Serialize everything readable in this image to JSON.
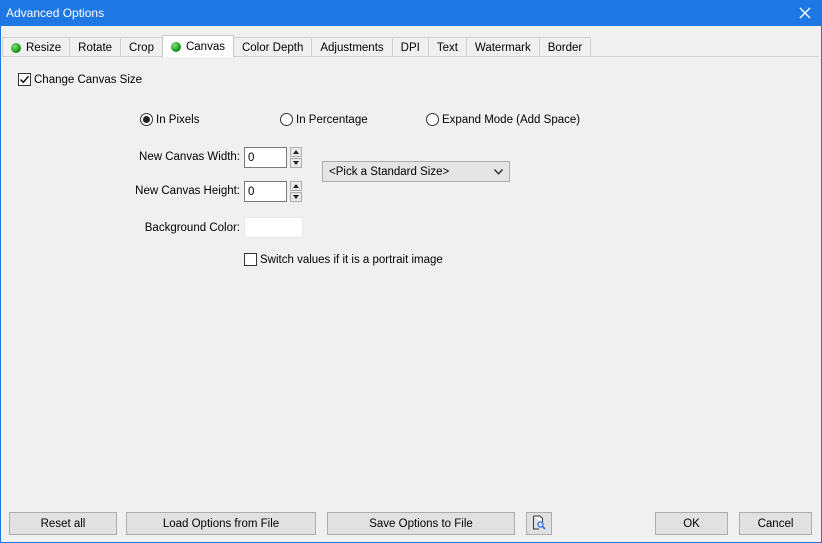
{
  "window": {
    "title": "Advanced Options"
  },
  "tabs": [
    {
      "label": "Resize",
      "indicator": true,
      "active": false
    },
    {
      "label": "Rotate",
      "indicator": false,
      "active": false
    },
    {
      "label": "Crop",
      "indicator": false,
      "active": false
    },
    {
      "label": "Canvas",
      "indicator": true,
      "active": true
    },
    {
      "label": "Color Depth",
      "indicator": false,
      "active": false
    },
    {
      "label": "Adjustments",
      "indicator": false,
      "active": false
    },
    {
      "label": "DPI",
      "indicator": false,
      "active": false
    },
    {
      "label": "Text",
      "indicator": false,
      "active": false
    },
    {
      "label": "Watermark",
      "indicator": false,
      "active": false
    },
    {
      "label": "Border",
      "indicator": false,
      "active": false
    }
  ],
  "canvas": {
    "change_size": {
      "label": "Change Canvas Size",
      "checked": true
    },
    "modes": [
      {
        "label": "In Pixels",
        "selected": true
      },
      {
        "label": "In Percentage",
        "selected": false
      },
      {
        "label": "Expand Mode (Add Space)",
        "selected": false
      }
    ],
    "width": {
      "label": "New Canvas Width:",
      "value": "0"
    },
    "height": {
      "label": "New Canvas Height:",
      "value": "0"
    },
    "standard_size": {
      "selected": "<Pick a Standard Size>"
    },
    "background": {
      "label": "Background Color:",
      "color": "#ffffff"
    },
    "switch_portrait": {
      "label": "Switch values if it is a portrait image",
      "checked": false
    }
  },
  "footer": {
    "reset_all": "Reset all",
    "load_options": "Load Options from File",
    "save_options": "Save Options to File",
    "preview_icon": "document-search-icon",
    "ok": "OK",
    "cancel": "Cancel"
  },
  "colors": {
    "titlebar": "#1e78e4",
    "indicator": "#1a9a1a"
  }
}
